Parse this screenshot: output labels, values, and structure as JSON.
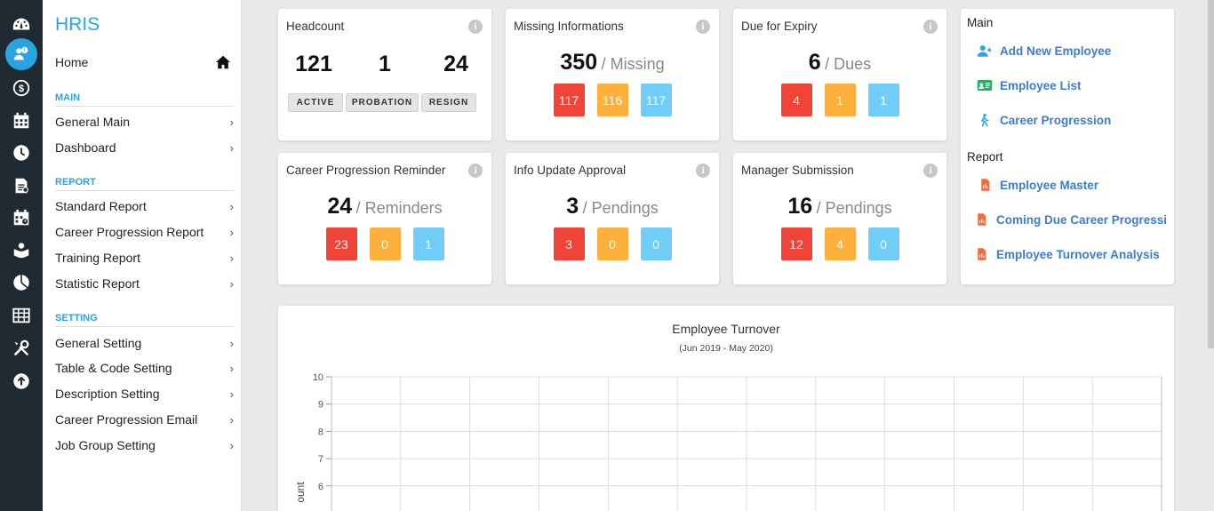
{
  "app": {
    "title": "HRIS"
  },
  "nav": {
    "home": "Home",
    "sections": {
      "main": "MAIN",
      "report": "REPORT",
      "setting": "SETTING"
    },
    "main_items": [
      "General Main",
      "Dashboard"
    ],
    "report_items": [
      "Standard Report",
      "Career Progression Report",
      "Training Report",
      "Statistic Report"
    ],
    "setting_items": [
      "General Setting",
      "Table & Code Setting",
      "Description Setting",
      "Career Progression Email",
      "Job Group Setting"
    ]
  },
  "rail_icons": [
    "dashboard-icon",
    "employees-icon",
    "payroll-icon",
    "calendar-icon",
    "clock-icon",
    "document-icon",
    "schedule-icon",
    "training-icon",
    "pie-chart-icon",
    "table-icon",
    "tools-icon",
    "upload-icon"
  ],
  "cards": {
    "headcount": {
      "title": "Headcount",
      "values": [
        "121",
        "1",
        "24"
      ],
      "labels": [
        "ACTIVE",
        "PROBATION",
        "RESIGN"
      ]
    },
    "missing": {
      "title": "Missing Informations",
      "value": "350",
      "unit": "/ Missing",
      "pills": [
        "117",
        "116",
        "117"
      ]
    },
    "expiry": {
      "title": "Due for Expiry",
      "value": "6",
      "unit": "/ Dues",
      "pills": [
        "4",
        "1",
        "1"
      ]
    },
    "career": {
      "title": "Career Progression Reminder",
      "value": "24",
      "unit": "/ Reminders",
      "pills": [
        "23",
        "0",
        "1"
      ]
    },
    "info_update": {
      "title": "Info Update Approval",
      "value": "3",
      "unit": "/ Pendings",
      "pills": [
        "3",
        "0",
        "0"
      ]
    },
    "manager": {
      "title": "Manager Submission",
      "value": "16",
      "unit": "/ Pendings",
      "pills": [
        "12",
        "4",
        "0"
      ]
    }
  },
  "quick_links": {
    "main_heading": "Main",
    "main_links": [
      "Add New Employee",
      "Employee List",
      "Career Progression"
    ],
    "report_heading": "Report",
    "report_links": [
      "Employee Master",
      "Coming Due Career Progressi",
      "Employee Turnover Analysis"
    ]
  },
  "chart_data": {
    "type": "line",
    "title": "Employee Turnover",
    "subtitle": "(Jun 2019 - May 2020)",
    "ylabel": "ount",
    "ylim": [
      0,
      10
    ],
    "yticks": [
      "10",
      "9",
      "8",
      "7",
      "6"
    ],
    "categories": [],
    "series": [],
    "grid": true
  },
  "colors": {
    "accent": "#2aa4e0",
    "red": "#f04438",
    "orange": "#fbb13c",
    "blue": "#6fcdf7",
    "link": "#3d7dca"
  }
}
